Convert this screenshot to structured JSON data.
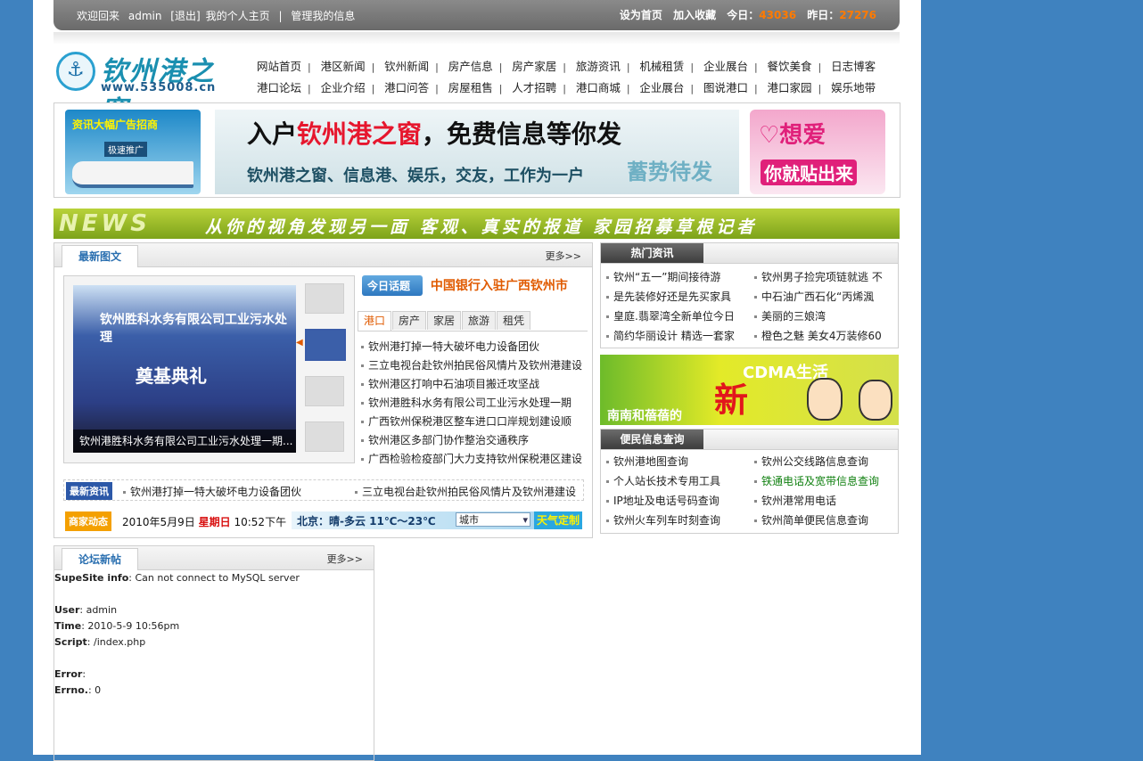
{
  "topbar": {
    "welcome": "欢迎回来",
    "user": "admin",
    "logout": "[退出]",
    "my_home": "我的个人主页",
    "manage": "管理我的信息",
    "set_home": "设为首页",
    "add_fav": "加入收藏",
    "today_label": "今日：",
    "today_value": "43036",
    "yesterday_label": "昨日：",
    "yesterday_value": "27276"
  },
  "logo": {
    "title": "钦州港之窗",
    "url": "www.535008.cn"
  },
  "nav": {
    "row1": [
      "网站首页",
      "港区新闻",
      "钦州新闻",
      "房产信息",
      "房产家居",
      "旅游资讯",
      "机械租赁",
      "企业展台",
      "餐饮美食",
      "日志博客"
    ],
    "row2": [
      "港口论坛",
      "企业介绍",
      "港口问答",
      "房屋租售",
      "人才招聘",
      "港口商城",
      "企业展台",
      "图说港口",
      "港口家园",
      "娱乐地带"
    ]
  },
  "banner": {
    "left_title": "资讯大幅广告招商",
    "left_sub": "极速推广",
    "center_head_a": "入户",
    "center_head_b": "钦州港之窗",
    "center_head_c": "，免费信息等你发",
    "center_sub": "钦州港之窗、信息港、娱乐，交友，工作为一户",
    "center_tag": "蓄势待发",
    "right_head": "♡想爱",
    "right_sub": "你就贴出来"
  },
  "newsstrip": {
    "news": "NEWS",
    "text": "从你的视角发现另一面  客观、真实的报道  家园招募草根记者"
  },
  "left_panel": {
    "tab": "最新图文",
    "more": "更多>>",
    "pic_banner": "钦州胜科水务有限公司工业污水处理",
    "pic_ceremony": "奠基典礼",
    "pic_caption": "钦州港胜科水务有限公司工业污水处理一期...",
    "topic_badge": "今日话题",
    "topic_title": "中国银行入驻广西钦州市",
    "tabs": [
      "港口",
      "房产",
      "家居",
      "旅游",
      "租凭"
    ],
    "news": [
      "钦州港打掉一特大破坏电力设备团伙",
      "三立电视台赴钦州拍民俗风情片及钦州港建设",
      "钦州港区打响中石油项目搬迁攻坚战",
      "钦州港胜科水务有限公司工业污水处理一期",
      "广西钦州保税港区整车进口口岸规划建设顺",
      "钦州港区多部门协作整治交通秩序",
      "广西检验检疫部门大力支持钦州保税港区建设"
    ],
    "latest_label": "最新资讯",
    "latest_items": [
      "钦州港打掉一特大破坏电力设备团伙",
      "三立电视台赴钦州拍民俗风情片及钦州港建设"
    ],
    "biz_label": "商家动态",
    "date": "2010年5月9日",
    "weekday": "星期日",
    "time": "10:52下午",
    "weather": "北京：晴-多云  11℃～23℃",
    "city": "城市",
    "custom": "天气定制"
  },
  "hot": {
    "label": "热门资讯",
    "items": [
      "钦州“五一”期间接待游",
      "钦州男子捡完项链就逃 不",
      "是先装修好还是先买家具",
      "中石油广西石化“丙烯渢",
      "皇庭.翡翠湾全新单位今日",
      "美丽的三娘湾",
      "简约华丽设计 精选一套家",
      "橙色之魅 美女4万装修60"
    ]
  },
  "cdma": {
    "left": "南南和蓓蓓的",
    "right": "CDMA生活",
    "big": "新"
  },
  "service": {
    "label": "便民信息查询",
    "items": [
      "钦州港地图查询",
      "钦州公交线路信息查询",
      "个人站长技术专用工具",
      "铁通电话及宽带信息查询",
      "IP地址及电话号码查询",
      "钦州港常用电话",
      "钦州火车列车时刻查询",
      "钦州简单便民信息查询"
    ]
  },
  "forum": {
    "tab": "论坛新帖",
    "more": "更多>>",
    "supesite_label": "SupeSite info",
    "supesite_msg": ": Can not connect to MySQL server",
    "user_label": "User",
    "user_val": ": admin",
    "time_label": "Time",
    "time_val": ": 2010-5-9 10:56pm",
    "script_label": "Script",
    "script_val": ": /index.php",
    "error_label": "Error",
    "error_val": ":",
    "errno_label": "Errno.",
    "errno_val": ": 0"
  },
  "colors": {
    "accent_orange": "#ff7a00",
    "link_blue": "#2a6fb0",
    "page_bg": "#3f82bf"
  }
}
